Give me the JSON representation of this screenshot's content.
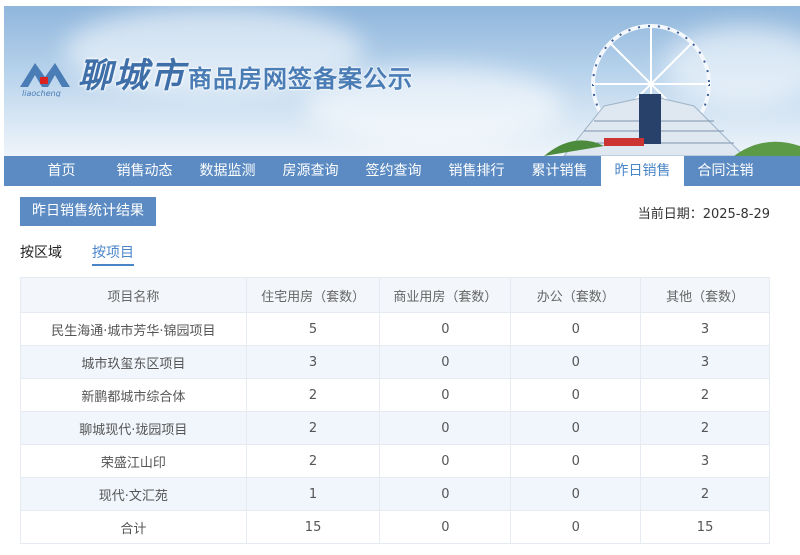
{
  "header": {
    "city_logo_text": "聊城市",
    "logo_sub": "liaocheng",
    "site_title": "商品房网签备案公示"
  },
  "nav": [
    "首页",
    "销售动态",
    "数据监测",
    "房源查询",
    "签约查询",
    "销售排行",
    "累计销售",
    "昨日销售",
    "合同注销"
  ],
  "nav_active": "昨日销售",
  "section_button": "昨日销售统计结果",
  "current_date": "当前日期：2025-8-29",
  "tabs": [
    "按区域",
    "按项目"
  ],
  "tab_active": "按项目",
  "table": {
    "columns": [
      "项目名称",
      "住宅用房（套数）",
      "商业用房（套数）",
      "办公（套数）",
      "其他（套数）"
    ],
    "rows": [
      [
        "民生海通·城市芳华·锦园项目",
        "5",
        "0",
        "0",
        "3"
      ],
      [
        "城市玖玺东区项目",
        "3",
        "0",
        "0",
        "3"
      ],
      [
        "新鹏都城市综合体",
        "2",
        "0",
        "0",
        "2"
      ],
      [
        "聊城现代·珑园项目",
        "2",
        "0",
        "0",
        "2"
      ],
      [
        "荣盛江山印",
        "2",
        "0",
        "0",
        "3"
      ],
      [
        "现代·文汇苑",
        "1",
        "0",
        "0",
        "2"
      ],
      [
        "合计",
        "15",
        "0",
        "0",
        "15"
      ]
    ]
  },
  "colors": {
    "accent": "#5b8bc2",
    "active_text": "#4a85c8"
  }
}
